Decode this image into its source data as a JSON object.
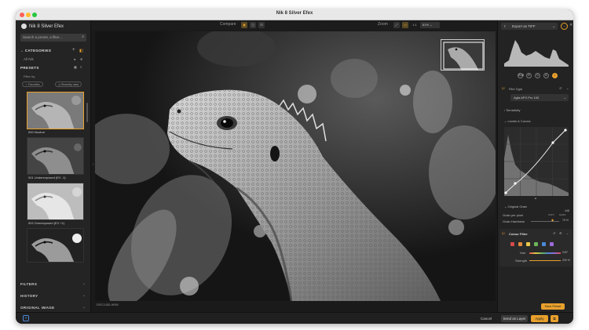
{
  "window": {
    "title": "Nik 8 Silver Efex"
  },
  "left_panel": {
    "brand": "Nik 8 Silver Efex",
    "search_placeholder": "Search a preset, a filter...",
    "categories": {
      "title": "CATEGORIES",
      "all_nik": "All Nik"
    },
    "presets": {
      "title": "PRESETS",
      "filter_by": "Filter by:",
      "favorites": "Favorites",
      "recently_used": "Recently used"
    },
    "items": [
      {
        "label": "000 Neutral"
      },
      {
        "label": "001 Underexposed (EV -1)"
      },
      {
        "label": "002 Overexposed (EV +1)"
      },
      {
        "label": ""
      }
    ],
    "sections": [
      "FILTERS",
      "HISTORY",
      "ORIGINAL IMAGE"
    ]
  },
  "toolbar": {
    "compare": "Compare",
    "zoom": "Zoom",
    "one_to_one": "1:1",
    "zoom_value": "61%"
  },
  "canvas": {
    "filename": "DSC1430.ARW"
  },
  "right_panel": {
    "export": "Export as TIFF",
    "channels": [
      "RGB",
      "R",
      "G",
      "B",
      "L"
    ],
    "film_type": {
      "title": "Film Type",
      "value": "Agfa APX Pro 100"
    },
    "sensitivity": "Sensitivity",
    "levels_curves": "Levels & Curves",
    "original_grain": "Original Grain",
    "grain_per_pixel": {
      "label": "Grain per pixel",
      "left": "SOFT",
      "right": "HARD",
      "value": "448"
    },
    "grain_hardness": {
      "label": "Grain Hardness",
      "value": "75 %"
    },
    "colour_filter": {
      "title": "Colour Filter",
      "hue_label": "Hue",
      "hue_value": "240°",
      "strength_label": "Strength",
      "strength_value": "200 %"
    },
    "swatch_colors": [
      "#d84a4a",
      "#e58a3a",
      "#e8c84a",
      "#6bb65a",
      "#4a8ad8",
      "#9a6ad8"
    ],
    "save_preset": "Save Preset"
  },
  "bottom": {
    "cancel": "Cancel",
    "send_as_layer": "Send as Layer",
    "apply": "Apply"
  },
  "colors": {
    "accent": "#e8a02c",
    "panel": "#232323",
    "canvas_bg": "#0d0d0d"
  }
}
